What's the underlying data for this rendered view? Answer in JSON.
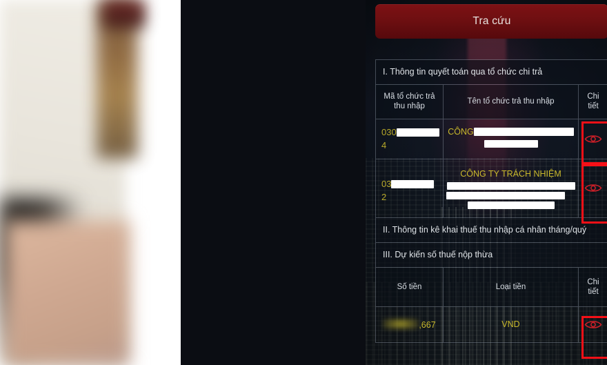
{
  "app": {
    "lookup_button": "Tra cứu"
  },
  "sections": {
    "section_1": "I. Thông tin quyết toán qua tổ chức chi trả",
    "section_2": "II. Thông tin kê khai thuế thu nhập cá nhân tháng/quý",
    "section_3": "III. Dự kiến số thuế nộp thừa"
  },
  "table_payers": {
    "headers": {
      "col_code": "Mã tổ chức trả thu nhập",
      "col_name": "Tên tổ chức trả thu nhập",
      "col_detail": "Chi tiết"
    },
    "rows": [
      {
        "code_prefix": "030",
        "code_suffix": "4",
        "name_prefix": "CÔNG",
        "detail_icon": "eye-icon"
      },
      {
        "code_prefix": "03",
        "code_suffix": "2",
        "name_prefix": "CÔNG TY TRÁCH NHIỆM",
        "detail_icon": "eye-icon"
      }
    ]
  },
  "table_refund": {
    "headers": {
      "col_amount": "Số tiền",
      "col_currency": "Loại tiền",
      "col_detail": "Chi tiết"
    },
    "rows": [
      {
        "amount_suffix": ",667",
        "currency": "VND",
        "detail_icon": "eye-icon"
      }
    ]
  },
  "colors": {
    "button_red": "#6d0f11",
    "annotation_red": "#f51017",
    "data_yellow": "#c9b92c",
    "header_text": "#d9dee4"
  }
}
